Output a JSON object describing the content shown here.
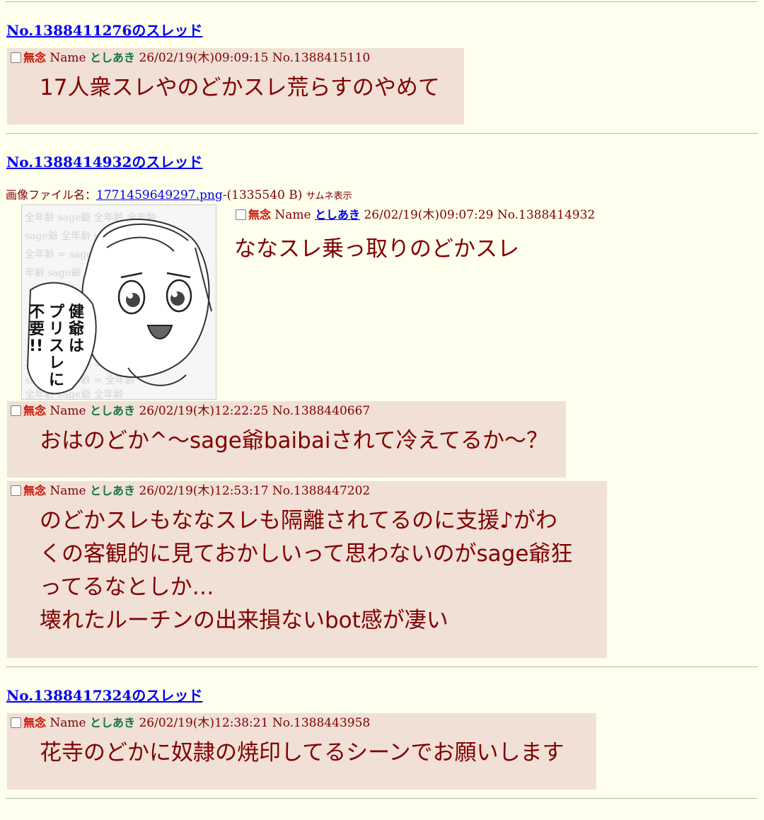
{
  "labels": {
    "subject": "無念",
    "name_label": "Name",
    "file_label": "画像ファイル名：",
    "thumb_label": "サムネ表示"
  },
  "threads": [
    {
      "title": "No.1388411276のスレッド",
      "replies": [
        {
          "name": "としあき",
          "datetime": "26/02/19(木)09:09:15",
          "no": "No.1388415110",
          "lines": [
            "17人衆スレやのどかスレ荒らすのやめて"
          ]
        }
      ]
    },
    {
      "title": "No.1388414932のスレッド",
      "op": {
        "file_name": "1771459649297.png",
        "file_size": "-(1335540 B)",
        "name": "としあき",
        "datetime": "26/02/19(木)09:07:29",
        "no": "No.1388414932",
        "lines": [
          "ななスレ乗っ取りのどかスレ"
        ],
        "image_text": [
          "健爺は",
          "プリスレに",
          "不要!!"
        ]
      },
      "replies": [
        {
          "name": "としあき",
          "datetime": "26/02/19(木)12:22:25",
          "no": "No.1388440667",
          "lines": [
            "おはのどか^〜sage爺baibaiされて冷えてるか〜？"
          ]
        },
        {
          "name": "としあき",
          "datetime": "26/02/19(木)12:53:17",
          "no": "No.1388447202",
          "lines": [
            "のどかスレもななスレも隔離されてるのに支援♪がわ",
            "くの客観的に見ておかしいって思わないのがsage爺狂",
            "ってるなとしか…",
            "壊れたルーチンの出来損ないbot感が凄い"
          ]
        }
      ]
    },
    {
      "title": "No.1388417324のスレッド",
      "replies": [
        {
          "name": "としあき",
          "datetime": "26/02/19(木)12:38:21",
          "no": "No.1388443958",
          "lines": [
            "花寺のどかに奴隷の焼印してるシーンでお願いします"
          ]
        }
      ]
    }
  ]
}
